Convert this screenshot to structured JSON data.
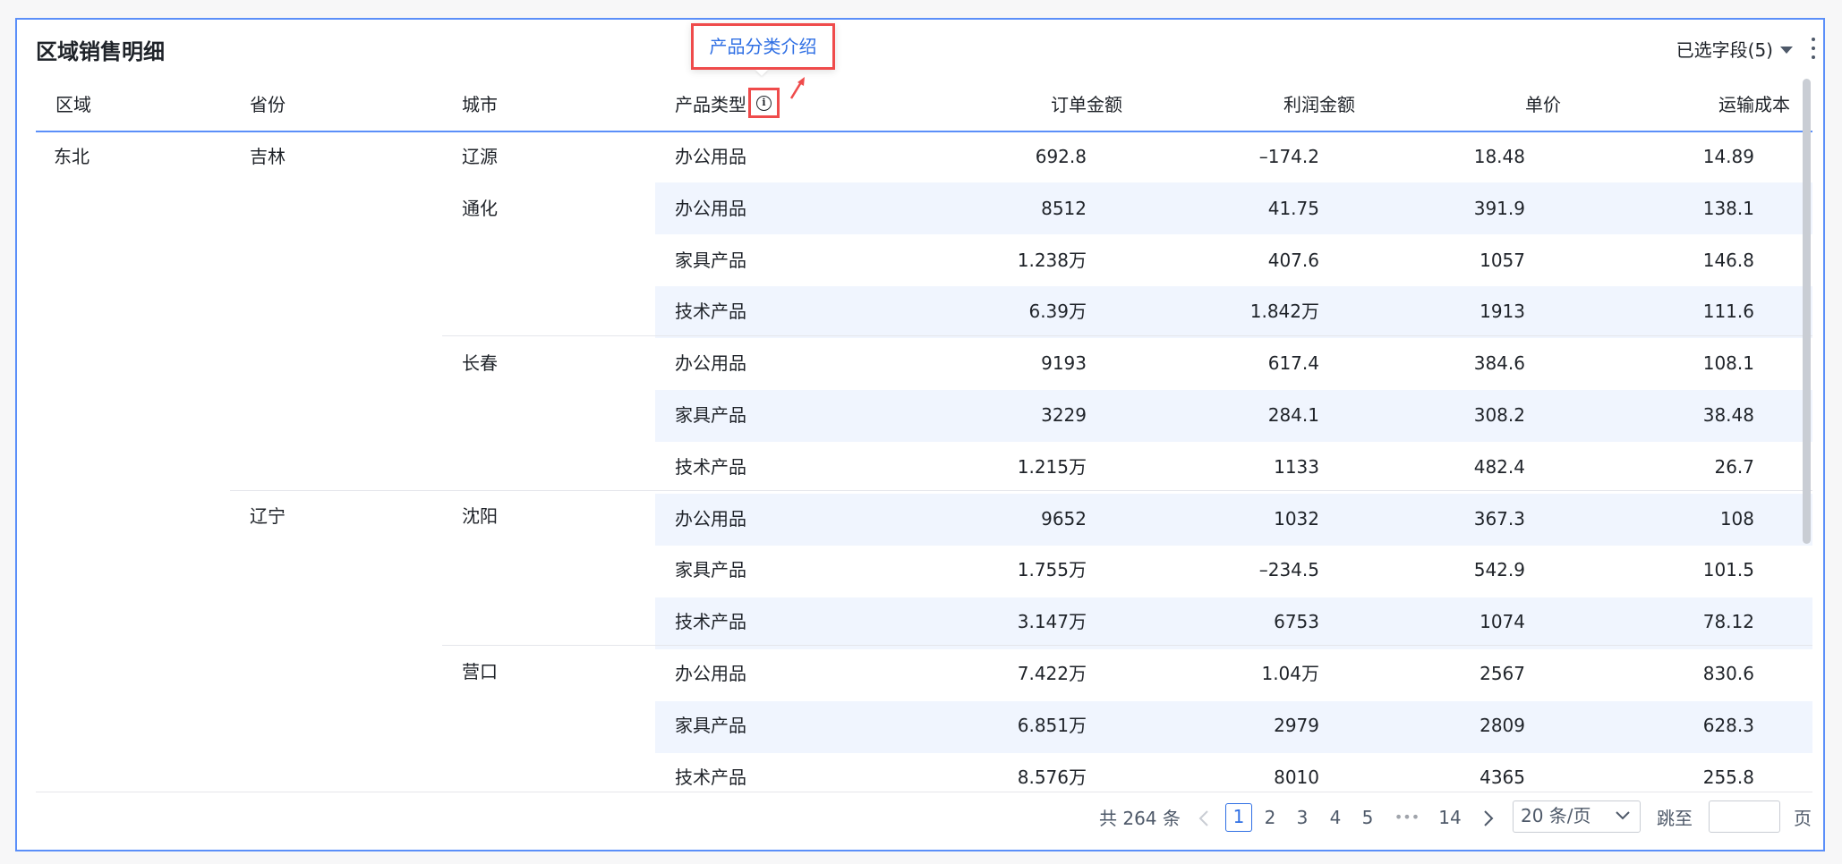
{
  "title": "区域销售明细",
  "fields_picker": "已选字段(5)",
  "tooltip": "产品分类介绍",
  "columns": [
    "区域",
    "省份",
    "城市",
    "产品类型",
    "订单金额",
    "利润金额",
    "单价",
    "运输成本"
  ],
  "groups": {
    "region": "东北",
    "provinces": [
      "吉林",
      "辽宁"
    ],
    "cities": [
      "辽源",
      "通化",
      "长春",
      "沈阳",
      "营口"
    ]
  },
  "rows": [
    {
      "type": "办公用品",
      "order": "692.8",
      "profit": "–174.2",
      "price": "18.48",
      "shipping": "14.89"
    },
    {
      "type": "办公用品",
      "order": "8512",
      "profit": "41.75",
      "price": "391.9",
      "shipping": "138.1"
    },
    {
      "type": "家具产品",
      "order": "1.238万",
      "profit": "407.6",
      "price": "1057",
      "shipping": "146.8"
    },
    {
      "type": "技术产品",
      "order": "6.39万",
      "profit": "1.842万",
      "price": "1913",
      "shipping": "111.6"
    },
    {
      "type": "办公用品",
      "order": "9193",
      "profit": "617.4",
      "price": "384.6",
      "shipping": "108.1"
    },
    {
      "type": "家具产品",
      "order": "3229",
      "profit": "284.1",
      "price": "308.2",
      "shipping": "38.48"
    },
    {
      "type": "技术产品",
      "order": "1.215万",
      "profit": "1133",
      "price": "482.4",
      "shipping": "26.7"
    },
    {
      "type": "办公用品",
      "order": "9652",
      "profit": "1032",
      "price": "367.3",
      "shipping": "108"
    },
    {
      "type": "家具产品",
      "order": "1.755万",
      "profit": "–234.5",
      "price": "542.9",
      "shipping": "101.5"
    },
    {
      "type": "技术产品",
      "order": "3.147万",
      "profit": "6753",
      "price": "1074",
      "shipping": "78.12"
    },
    {
      "type": "办公用品",
      "order": "7.422万",
      "profit": "1.04万",
      "price": "2567",
      "shipping": "830.6"
    },
    {
      "type": "家具产品",
      "order": "6.851万",
      "profit": "2979",
      "price": "2809",
      "shipping": "628.3"
    },
    {
      "type": "技术产品",
      "order": "8.576万",
      "profit": "8010",
      "price": "4365",
      "shipping": "255.8"
    }
  ],
  "pagination": {
    "total": "共 264 条",
    "pages": [
      "1",
      "2",
      "3",
      "4",
      "5"
    ],
    "ellipsis": "•••",
    "last": "14",
    "current": "1",
    "page_size": "20 条/页",
    "jump_label": "跳至",
    "page_suffix": "页"
  },
  "colors": {
    "accent": "#2f6fe4",
    "border": "#5b8ff9",
    "stripe": "#f0f5fe",
    "annotation": "#ef4b4b"
  }
}
